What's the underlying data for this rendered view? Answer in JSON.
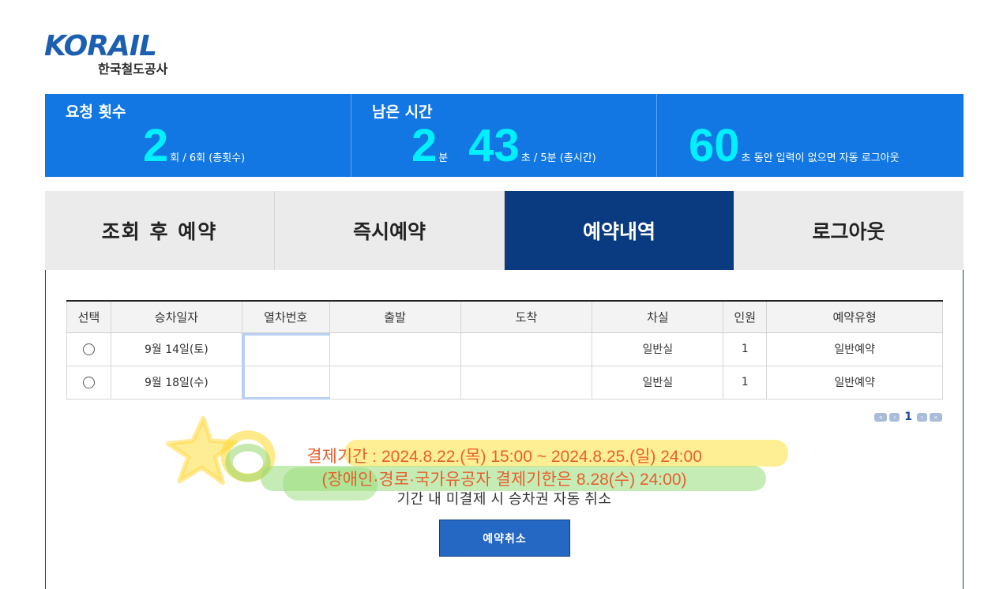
{
  "logo": {
    "word": "KORAIL",
    "subtitle": "한국철도공사"
  },
  "status": {
    "requests": {
      "label": "요청 횟수",
      "value": "2",
      "unit": "회 / 6회 (총횟수)"
    },
    "remaining": {
      "label": "남은 시간",
      "minutes": "2",
      "minutes_unit": "분",
      "seconds": "43",
      "seconds_unit": "초 / 5분 (총시간)"
    },
    "idle": {
      "value": "60",
      "unit": "초 동안 입력이 없으면 자동 로그아웃"
    }
  },
  "tabs": [
    {
      "label": "조회 후 예약"
    },
    {
      "label": "즉시예약"
    },
    {
      "label": "예약내역"
    },
    {
      "label": "로그아웃"
    }
  ],
  "table": {
    "headers": [
      "선택",
      "승차일자",
      "열차번호",
      "출발",
      "도착",
      "차실",
      "인원",
      "예약유형"
    ],
    "rows": [
      {
        "date": "9월 14일(토)",
        "train": "",
        "departure": "",
        "arrival": "",
        "class": "일반실",
        "count": "1",
        "type": "일반예약"
      },
      {
        "date": "9월 18일(수)",
        "train": "",
        "departure": "",
        "arrival": "",
        "class": "일반실",
        "count": "1",
        "type": "일반예약"
      }
    ]
  },
  "pagination": {
    "first": "«",
    "prev": "‹",
    "current": "1",
    "next": "›",
    "last": "»"
  },
  "notice": {
    "line1": "결제기간 : 2024.8.22.(목) 15:00 ~ 2024.8.25.(일) 24:00",
    "line2": "(장애인·경로·국가유공자 결제기한은 8.28(수) 24:00)",
    "line3": "기간 내 미결제 시 승차권 자동 취소"
  },
  "cancel_button": "예약취소",
  "colors": {
    "status_bg": "#1277e3",
    "highlight_number": "#00f0ff",
    "active_tab": "#0a3a80",
    "notice_text": "#e8602c",
    "button": "#2468c4"
  }
}
